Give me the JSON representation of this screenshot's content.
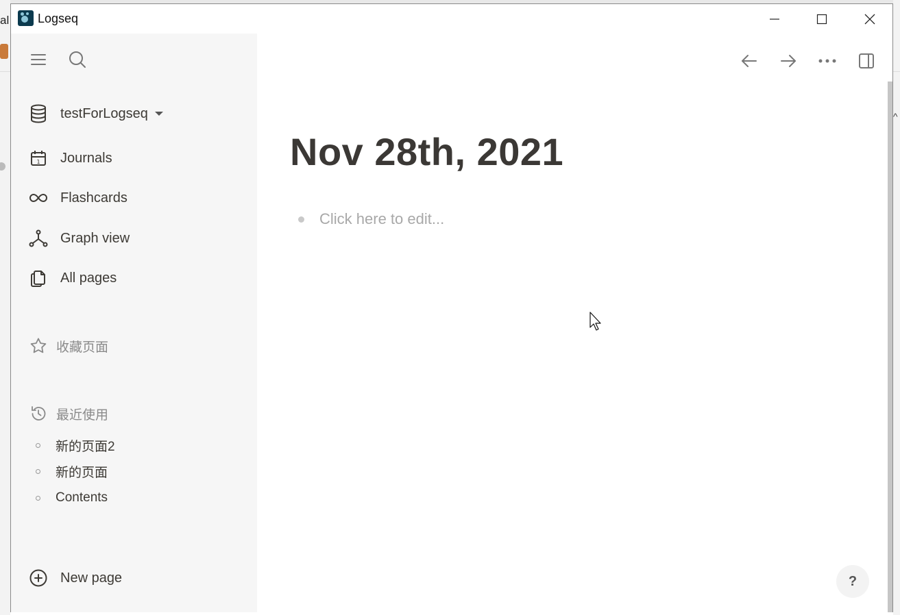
{
  "background": {
    "left_fragment": "al",
    "right_fragment": "^"
  },
  "window": {
    "title": "Logseq",
    "controls": {
      "minimize": "minimize-icon",
      "maximize": "maximize-icon",
      "close": "close-icon"
    }
  },
  "sidebar": {
    "repo": {
      "name": "testForLogseq",
      "icon": "database-icon"
    },
    "nav": [
      {
        "label": "Journals",
        "icon": "calendar-icon"
      },
      {
        "label": "Flashcards",
        "icon": "infinity-icon"
      },
      {
        "label": "Graph view",
        "icon": "graph-icon"
      },
      {
        "label": "All pages",
        "icon": "pages-icon"
      }
    ],
    "favorites": {
      "label": "收藏页面",
      "icon": "star-icon"
    },
    "recent": {
      "label": "最近使用",
      "icon": "history-icon",
      "items": [
        "新的页面2",
        "新的页面",
        "Contents"
      ]
    },
    "new_page": {
      "label": "New page",
      "icon": "plus-circle-icon"
    }
  },
  "main": {
    "title": "Nov 28th, 2021",
    "block_placeholder": "Click here to edit...",
    "help_label": "?"
  },
  "colors": {
    "sidebar_bg": "#f6f6f6",
    "text": "#3d3a35",
    "muted": "#8a8a8a",
    "app_icon": "#0b3a4e"
  }
}
